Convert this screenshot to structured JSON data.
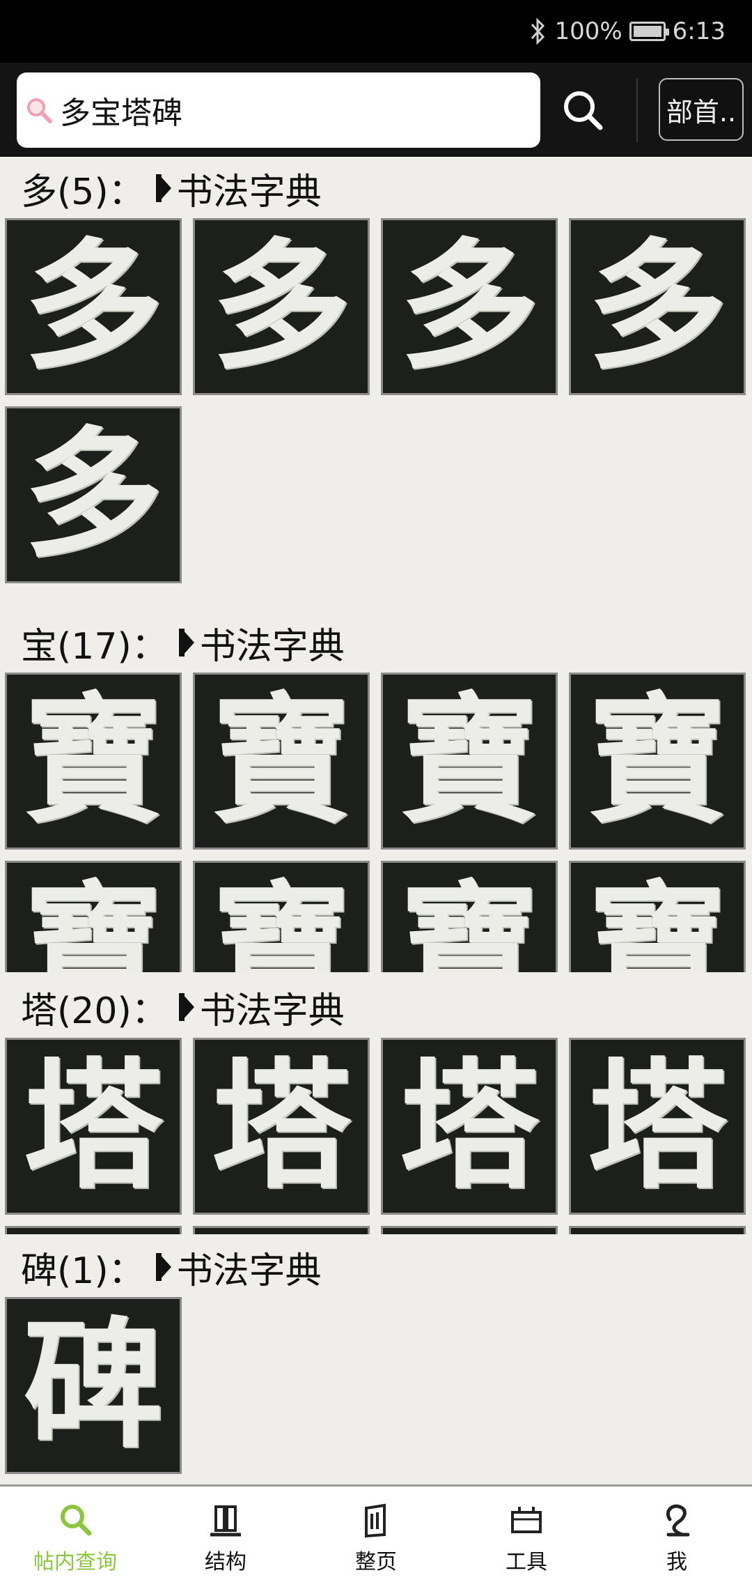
{
  "status_bar": {
    "battery": "100%",
    "time": "6:13"
  },
  "search": {
    "query": "多宝塔碑",
    "radical_button": "部首.."
  },
  "dictionary_link": "书法字典",
  "sections": [
    {
      "char": "多",
      "count_label": "多(5)："
    },
    {
      "char": "寶",
      "count_label": "宝(17)："
    },
    {
      "char": "塔",
      "count_label": "塔(20)："
    },
    {
      "char": "碑",
      "count_label": "碑(1)："
    }
  ],
  "nav": {
    "items": [
      {
        "label": "帖内查询",
        "icon": "search-icon",
        "active": true
      },
      {
        "label": "结构",
        "icon": "structure-icon"
      },
      {
        "label": "整页",
        "icon": "page-icon"
      },
      {
        "label": "工具",
        "icon": "tools-icon"
      },
      {
        "label": "我",
        "icon": "profile-icon"
      }
    ]
  },
  "colors": {
    "accent": "#8cc63f",
    "tile_bg": "#1c1f1b",
    "header_bg": "#141414"
  }
}
